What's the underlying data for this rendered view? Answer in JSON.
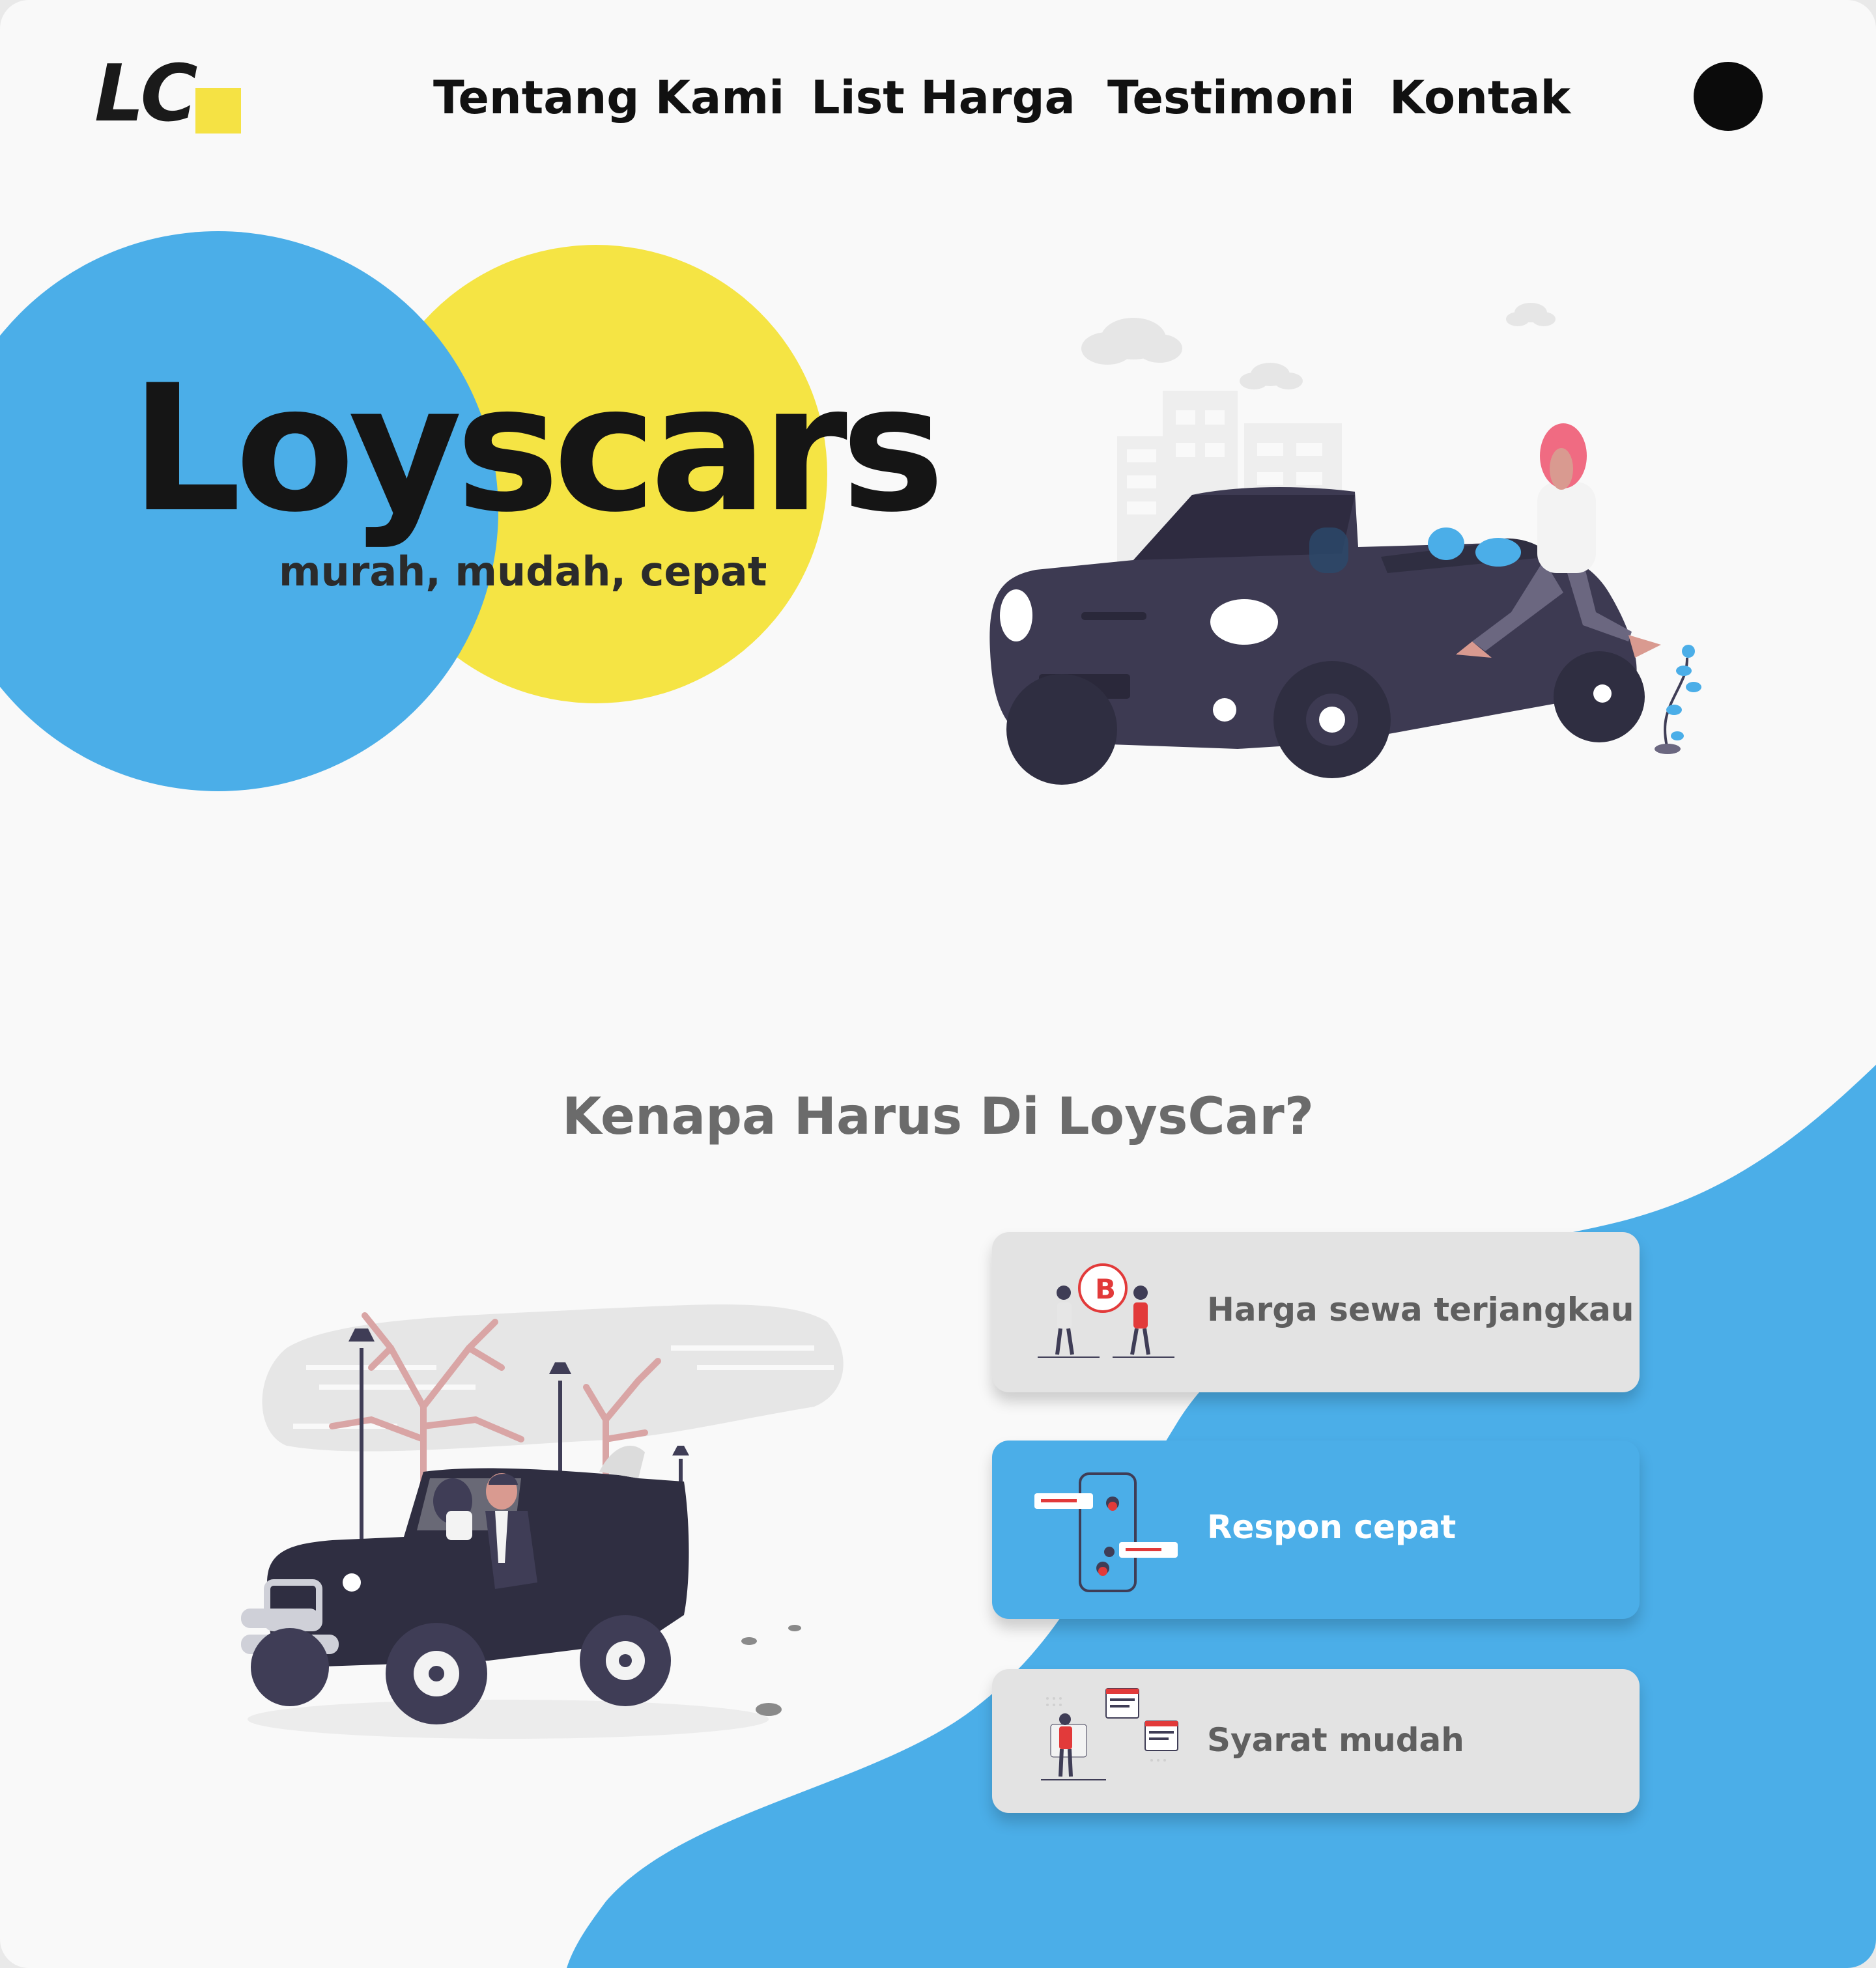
{
  "brand": {
    "logo_text": "LC",
    "accent_yellow": "#f5e444",
    "accent_blue": "#4baee8"
  },
  "nav": {
    "items": [
      {
        "label": "Tentang Kami"
      },
      {
        "label": "List Harga"
      },
      {
        "label": "Testimoni"
      },
      {
        "label": "Kontak"
      }
    ]
  },
  "hero": {
    "title": "Loyscars",
    "subtitle": "murah, mudah, cepat"
  },
  "features": {
    "title": "Kenapa Harus Di LoysCar?",
    "cards": [
      {
        "label": "Harga sewa terjangkau",
        "icon": "price-exchange-icon"
      },
      {
        "label": "Respon cepat",
        "icon": "chat-phone-icon"
      },
      {
        "label": "Syarat mudah",
        "icon": "documents-icon"
      }
    ]
  }
}
